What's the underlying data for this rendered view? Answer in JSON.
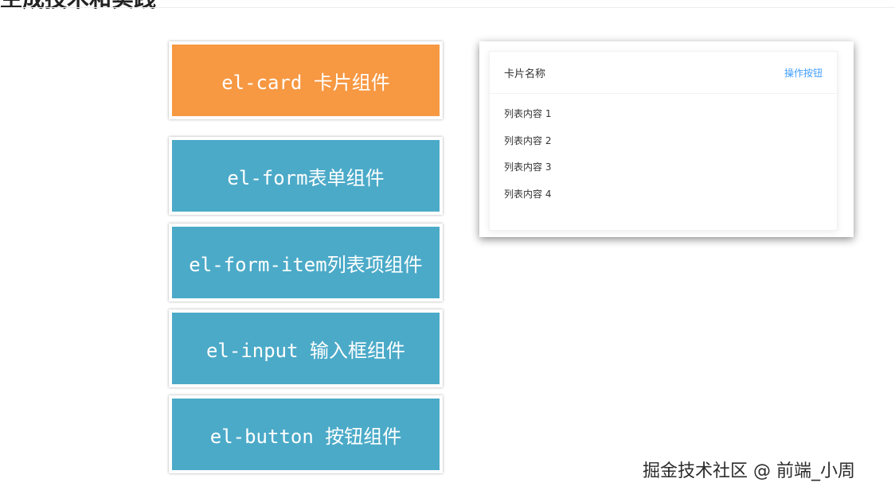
{
  "heading": "生成技术和实践",
  "components": {
    "card": "el-card 卡片组件",
    "form": "el-form表单组件",
    "form_item": "el-form-item列表项组件",
    "input": "el-input 输入框组件",
    "button": "el-button 按钮组件"
  },
  "card_preview": {
    "title": "卡片名称",
    "action": "操作按钮",
    "items": [
      "列表内容 1",
      "列表内容 2",
      "列表内容 3",
      "列表内容 4"
    ]
  },
  "watermark": "掘金技术社区 @ 前端_小周",
  "colors": {
    "card_box": "#f79842",
    "component_box": "#4baac8",
    "action_link": "#409eff"
  }
}
